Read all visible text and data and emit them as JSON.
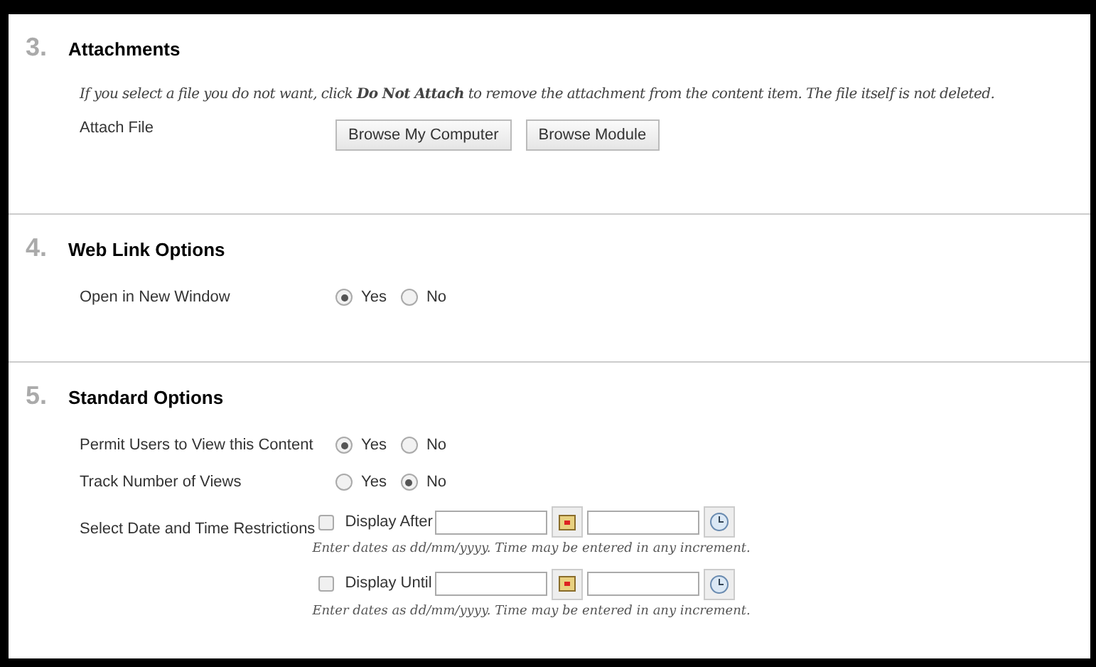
{
  "sections": [
    {
      "number": "3.",
      "title": "Attachments",
      "note": "If you select a file you do not want, click **Do Not Attach** to remove the attachment from the content item. The file itself is not deleted.",
      "rows": [
        {
          "kind": "buttons",
          "label": "Attach File",
          "buttons": [
            "Browse My Computer",
            "Browse Module"
          ]
        }
      ]
    },
    {
      "number": "4.",
      "title": "Web Link Options",
      "rows": [
        {
          "kind": "radio",
          "label": "Open in New Window",
          "options": [
            {
              "label": "Yes",
              "selected": true
            },
            {
              "label": "No",
              "selected": false
            }
          ]
        }
      ]
    },
    {
      "number": "5.",
      "title": "Standard Options",
      "rows": [
        {
          "kind": "radio",
          "label": "Permit Users to View this Content",
          "options": [
            {
              "label": "Yes",
              "selected": true
            },
            {
              "label": "No",
              "selected": false
            }
          ]
        },
        {
          "kind": "radio",
          "label": "Track Number of Views",
          "options": [
            {
              "label": "Yes",
              "selected": false
            },
            {
              "label": "No",
              "selected": true
            }
          ]
        },
        {
          "kind": "dates",
          "label": "Select Date and Time Restrictions",
          "entries": [
            {
              "label": "Display After",
              "checked": false,
              "hint": "Enter dates as dd/mm/yyyy. Time may be entered in any increment."
            },
            {
              "label": "Display Until",
              "checked": false,
              "hint": "Enter dates as dd/mm/yyyy. Time may be entered in any increment."
            }
          ]
        }
      ]
    }
  ]
}
